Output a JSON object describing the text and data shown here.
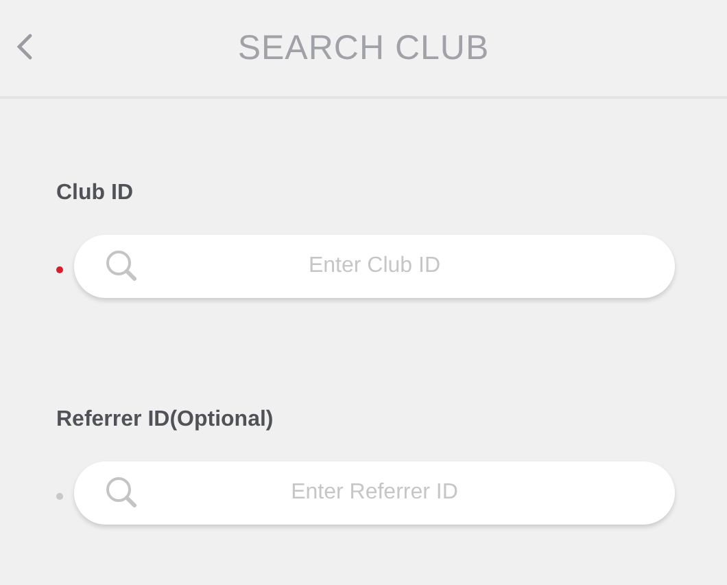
{
  "header": {
    "title": "SEARCH CLUB"
  },
  "fields": [
    {
      "label": "Club ID",
      "placeholder": "Enter Club ID",
      "required": true
    },
    {
      "label": "Referrer ID(Optional)",
      "placeholder": "Enter Referrer ID",
      "required": false
    }
  ]
}
